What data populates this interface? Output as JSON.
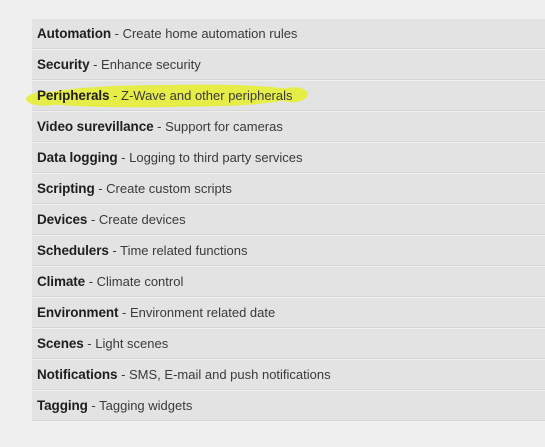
{
  "menu": {
    "highlight_color": "#e8ef2c",
    "items": [
      {
        "name": "Automation",
        "separator": " - ",
        "description": "Create home automation rules"
      },
      {
        "name": "Security",
        "separator": " - ",
        "description": "Enhance security"
      },
      {
        "name": "Peripherals",
        "separator": " - ",
        "description": "Z-Wave and other peripherals",
        "highlighted": true
      },
      {
        "name": "Video surevillance",
        "separator": " - ",
        "description": "Support for cameras"
      },
      {
        "name": "Data logging",
        "separator": " - ",
        "description": "Logging to third party services"
      },
      {
        "name": "Scripting",
        "separator": " - ",
        "description": "Create custom scripts"
      },
      {
        "name": "Devices",
        "separator": " - ",
        "description": "Create devices"
      },
      {
        "name": "Schedulers",
        "separator": " - ",
        "description": "Time related functions"
      },
      {
        "name": "Climate",
        "separator": " - ",
        "description": "Climate control"
      },
      {
        "name": "Environment",
        "separator": " - ",
        "description": "Environment related date"
      },
      {
        "name": "Scenes",
        "separator": " - ",
        "description": "Light scenes"
      },
      {
        "name": "Notifications",
        "separator": " - ",
        "description": "SMS, E-mail and push notifications"
      },
      {
        "name": "Tagging",
        "separator": " - ",
        "description": "Tagging widgets"
      }
    ]
  }
}
